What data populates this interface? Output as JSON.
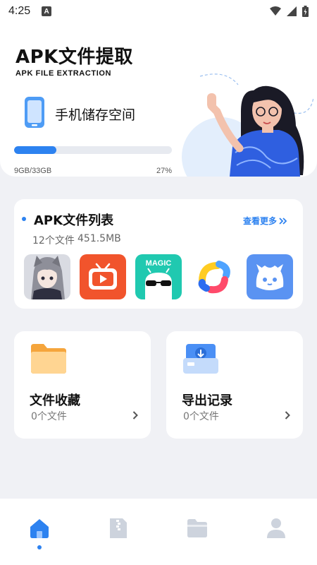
{
  "status_bar": {
    "time": "4:25",
    "notification_badge": "A"
  },
  "header": {
    "title": "APK文件提取",
    "subtitle": "APK FILE EXTRACTION",
    "storage_label": "手机储存空间",
    "storage_used": "9GB/33GB",
    "storage_percent": "27%",
    "storage_fraction": 0.27
  },
  "apk_list": {
    "title": "APK文件列表",
    "file_count": "12个文件",
    "total_size": "451.5MB",
    "view_more": "查看更多",
    "app_icons": [
      {
        "icon": "anime-girl-app-icon"
      },
      {
        "icon": "red-tv-app-icon"
      },
      {
        "icon": "magic-robot-app-icon",
        "text": "MAGIC"
      },
      {
        "icon": "colorful-ring-app-icon"
      },
      {
        "icon": "blue-bunny-app-icon"
      }
    ]
  },
  "favorites": {
    "title": "文件收藏",
    "count": "0个文件",
    "icon": "folder-icon"
  },
  "export_records": {
    "title": "导出记录",
    "count": "0个文件",
    "icon": "export-box-icon"
  },
  "tab_bar": {
    "active_tab": "home",
    "tabs": [
      {
        "name": "home",
        "icon": "home-icon"
      },
      {
        "name": "archive",
        "icon": "zip-file-icon"
      },
      {
        "name": "files",
        "icon": "folder-tab-icon"
      },
      {
        "name": "profile",
        "icon": "user-icon"
      }
    ]
  },
  "colors": {
    "accent": "#2d82f0",
    "background": "#f0f1f5",
    "card": "#ffffff"
  }
}
